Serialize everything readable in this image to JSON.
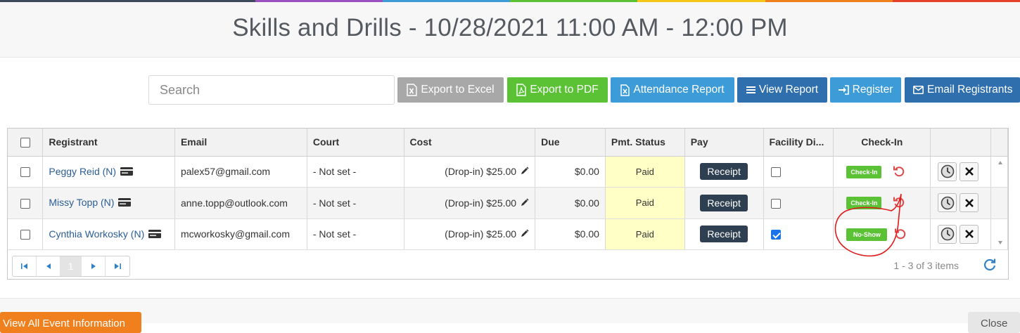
{
  "page": {
    "title": "Skills and Drills - 10/28/2021 11:00 AM - 12:00 PM"
  },
  "colors": {
    "rainbow": [
      "#3d4a5c",
      "#3d4a5c",
      "#9b4fc0",
      "#3d9bd8",
      "#5bc236",
      "#f5c518",
      "#f0801d",
      "#e5402a"
    ]
  },
  "toolbar": {
    "search_placeholder": "Search",
    "export_excel": "Export to Excel",
    "export_pdf": "Export to PDF",
    "attendance_report": "Attendance Report",
    "view_report": "View Report",
    "register": "Register",
    "email_registrants": "Email Registrants"
  },
  "table": {
    "columns": [
      "Registrant",
      "Email",
      "Court",
      "Cost",
      "Due",
      "Pmt. Status",
      "Pay",
      "Facility Di...",
      "Check-In"
    ],
    "rows": [
      {
        "registrant": "Peggy Reid (N)",
        "email": "palex57@gmail.com",
        "court": "- Not set -",
        "cost": "(Drop-in) $25.00",
        "due": "$0.00",
        "status": "Paid",
        "pay": "Receipt",
        "facility": false,
        "checkin": "Check-In"
      },
      {
        "registrant": "Missy Topp (N)",
        "email": "anne.topp@outlook.com",
        "court": "- Not set -",
        "cost": "(Drop-in) $25.00",
        "due": "$0.00",
        "status": "Paid",
        "pay": "Receipt",
        "facility": false,
        "checkin": "Check-In"
      },
      {
        "registrant": "Cynthia Workosky (N)",
        "email": "mcworkosky@gmail.com",
        "court": "- Not set -",
        "cost": "(Drop-in) $25.00",
        "due": "$0.00",
        "status": "Paid",
        "pay": "Receipt",
        "facility": true,
        "checkin": "No-Show"
      }
    ]
  },
  "pager": {
    "current_page": "1",
    "items_text": "1 - 3 of 3 items"
  },
  "footer": {
    "view_all": "View All Event Information",
    "close": "Close"
  }
}
